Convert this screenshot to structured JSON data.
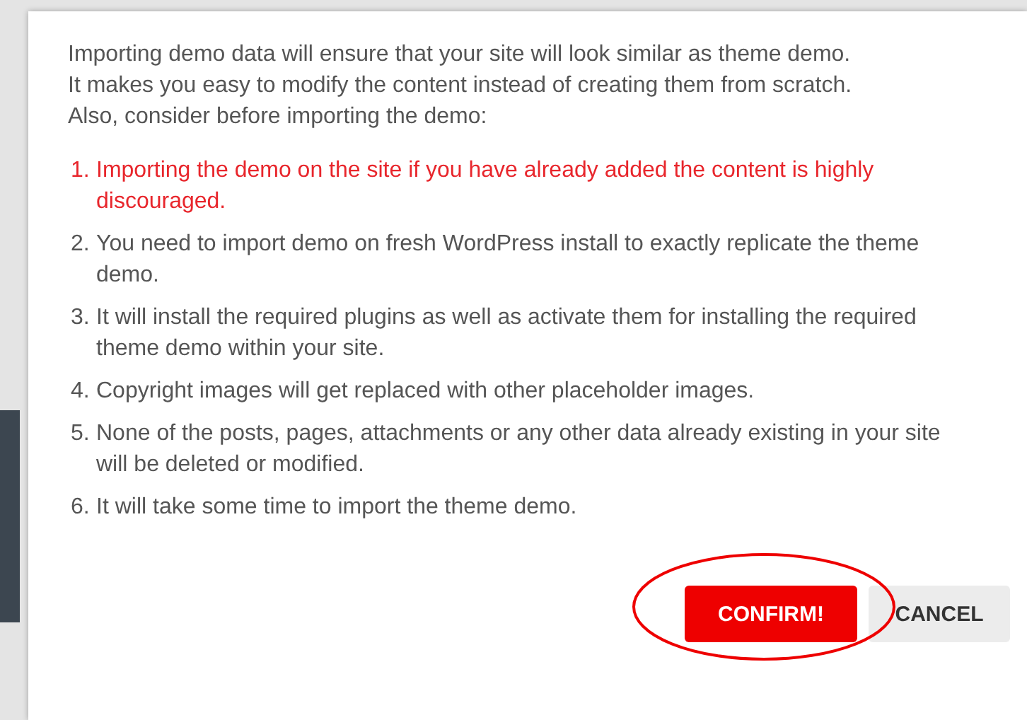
{
  "dialog": {
    "intro_lines": [
      "Importing demo data will ensure that your site will look similar as theme demo.",
      "It makes you easy to modify the content instead of creating them from scratch.",
      "Also, consider before importing the demo:"
    ],
    "items": [
      {
        "number": "1.",
        "text": "Importing the demo on the site if you have already added the content is highly discouraged.",
        "highlighted": true
      },
      {
        "number": "2.",
        "text": "You need to import demo on fresh WordPress install to exactly replicate the theme demo.",
        "highlighted": false
      },
      {
        "number": "3.",
        "text": "It will install the required plugins as well as activate them for installing the required theme demo within your site.",
        "highlighted": false
      },
      {
        "number": "4.",
        "text": "Copyright images will get replaced with other placeholder images.",
        "highlighted": false
      },
      {
        "number": "5.",
        "text": "None of the posts, pages, attachments or any other data already existing in your site will be deleted or modified.",
        "highlighted": false
      },
      {
        "number": "6.",
        "text": "It will take some time to import the theme demo.",
        "highlighted": false
      }
    ],
    "buttons": [
      {
        "label": "CONFIRM!",
        "kind": "primary"
      },
      {
        "label": "CANCEL",
        "kind": "secondary"
      }
    ]
  }
}
